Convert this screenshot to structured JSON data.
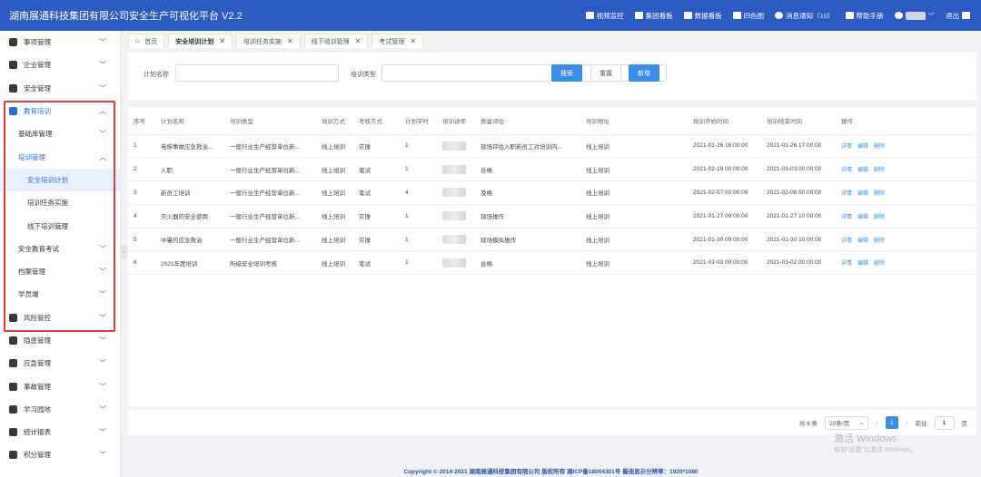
{
  "header": {
    "title": "湖南展通科技集团有限公司安全生产可视化平台  V2.2",
    "nav": [
      {
        "icon": "video-camera-icon",
        "label": "视频监控"
      },
      {
        "icon": "map-icon",
        "label": "集团看板"
      },
      {
        "icon": "chart-icon",
        "label": "数据看板"
      },
      {
        "icon": "cube-icon",
        "label": "四色图"
      },
      {
        "icon": "bell-icon",
        "label": "消息通知（10）"
      },
      {
        "icon": "book-icon",
        "label": "帮助手册"
      }
    ],
    "logout": "退出"
  },
  "sidebar": {
    "items": [
      {
        "label": "事项管理",
        "icon": "clipboard-icon",
        "chev": "﹀"
      },
      {
        "label": "企业管理",
        "icon": "building-icon",
        "chev": "﹀"
      },
      {
        "label": "安全管理",
        "icon": "shield-icon",
        "chev": "﹀"
      },
      {
        "label": "教育培训",
        "icon": "graduation-cap-icon",
        "chev": "︿"
      },
      {
        "label": "基础库管理",
        "chev": "﹀"
      },
      {
        "label": "培训管理",
        "chev": "︿"
      },
      {
        "label": "安全培训计划"
      },
      {
        "label": "培训任务实施"
      },
      {
        "label": "线下培训管理"
      },
      {
        "label": "安全教育考试",
        "chev": "﹀"
      },
      {
        "label": "档案管理",
        "chev": "﹀"
      },
      {
        "label": "学员端",
        "chev": "﹀"
      },
      {
        "label": "风险管控",
        "icon": "risk-icon",
        "chev": "﹀"
      },
      {
        "label": "隐患管理",
        "icon": "warning-icon",
        "chev": "﹀"
      },
      {
        "label": "应急管理",
        "icon": "emergency-icon",
        "chev": "﹀"
      },
      {
        "label": "事故管理",
        "icon": "accident-icon",
        "chev": "﹀"
      },
      {
        "label": "学习园地",
        "icon": "study-icon",
        "chev": "﹀"
      },
      {
        "label": "统计报表",
        "icon": "bar-chart-icon",
        "chev": "﹀"
      },
      {
        "label": "积分管理",
        "icon": "points-icon",
        "chev": "﹀"
      }
    ]
  },
  "tabs": [
    {
      "label": "首页"
    },
    {
      "label": "安全培训计划",
      "close": "✕"
    },
    {
      "label": "培训任务实施",
      "close": "✕"
    },
    {
      "label": "线下培训管理",
      "close": "✕"
    },
    {
      "label": "考试管理",
      "close": "✕"
    }
  ],
  "search": {
    "plan_name_label": "计划名称",
    "plan_name_value": "",
    "type_label": "培训类型",
    "type_value": "",
    "search_btn": "搜索",
    "reset_btn": "重置",
    "add_btn": "新增"
  },
  "table": {
    "columns": [
      "序号",
      "计划名称",
      "培训类型",
      "培训方式",
      "考核方式",
      "计划学时",
      "培训讲师",
      "质量评估",
      "培训地址",
      "培训开始时间",
      "培训结束时间",
      "操作"
    ],
    "rows": [
      {
        "no": "1",
        "name": "电梯事故应急救治...",
        "type": "一般行业生产经营单位新...",
        "mode": "线上培训",
        "exam": "实操",
        "hours": "1",
        "eval": "现场评估入职新员工对培训内...",
        "addr": "线上培训",
        "start": "2021-01-26 16:00:00",
        "end": "2021-01-26 17:00:00"
      },
      {
        "no": "2",
        "name": "入职",
        "type": "一般行业生产经营单位新...",
        "mode": "线上培训",
        "exam": "笔试",
        "hours": "1",
        "eval": "合格",
        "addr": "线上培训",
        "start": "2021-02-19 00:00:00",
        "end": "2021-03-03 00:00:00"
      },
      {
        "no": "3",
        "name": "新员工培训",
        "type": "一般行业生产经营单位新...",
        "mode": "线上培训",
        "exam": "笔试",
        "hours": "4",
        "eval": "及格",
        "addr": "线上培训",
        "start": "2021-02-07 00:00:00",
        "end": "2021-02-08 00:00:00"
      },
      {
        "no": "4",
        "name": "灭火器的安全使用",
        "type": "一般行业生产经营单位新...",
        "mode": "线上培训",
        "exam": "实操",
        "hours": "1",
        "eval": "现场操作",
        "addr": "线上培训",
        "start": "2021-01-27 09:00:00",
        "end": "2021-01-27 10:00:00"
      },
      {
        "no": "5",
        "name": "中暑的应急救治",
        "type": "一般行业生产经营单位新...",
        "mode": "线上培训",
        "exam": "实操",
        "hours": "1",
        "eval": "现场模拟操作",
        "addr": "线上培训",
        "start": "2021-01-30 09:00:00",
        "end": "2021-01-30 10:00:00"
      },
      {
        "no": "6",
        "name": "2021年度培训",
        "type": "所级安全培训考核",
        "mode": "线上培训",
        "exam": "笔试",
        "hours": "1",
        "eval": "合格",
        "addr": "线上培训",
        "start": "2021-02-03 00:00:00",
        "end": "2021-03-02 00:00:00"
      }
    ],
    "ops": [
      "详情",
      "编辑",
      "删除"
    ]
  },
  "pager": {
    "total": "共 6 条",
    "size": "20条/页",
    "page": "1",
    "goto": "前往",
    "goto_value": "1",
    "unit": "页"
  },
  "watermark": {
    "line1": "激活 Windows",
    "line2": "转到\"设置\"以激活 Windows。"
  },
  "footer": "Copyright © 2014-2021 湖南展通科技集团有限公司 版权所有 湘ICP备18004301号 最佳显示分辨率：1920*1080"
}
